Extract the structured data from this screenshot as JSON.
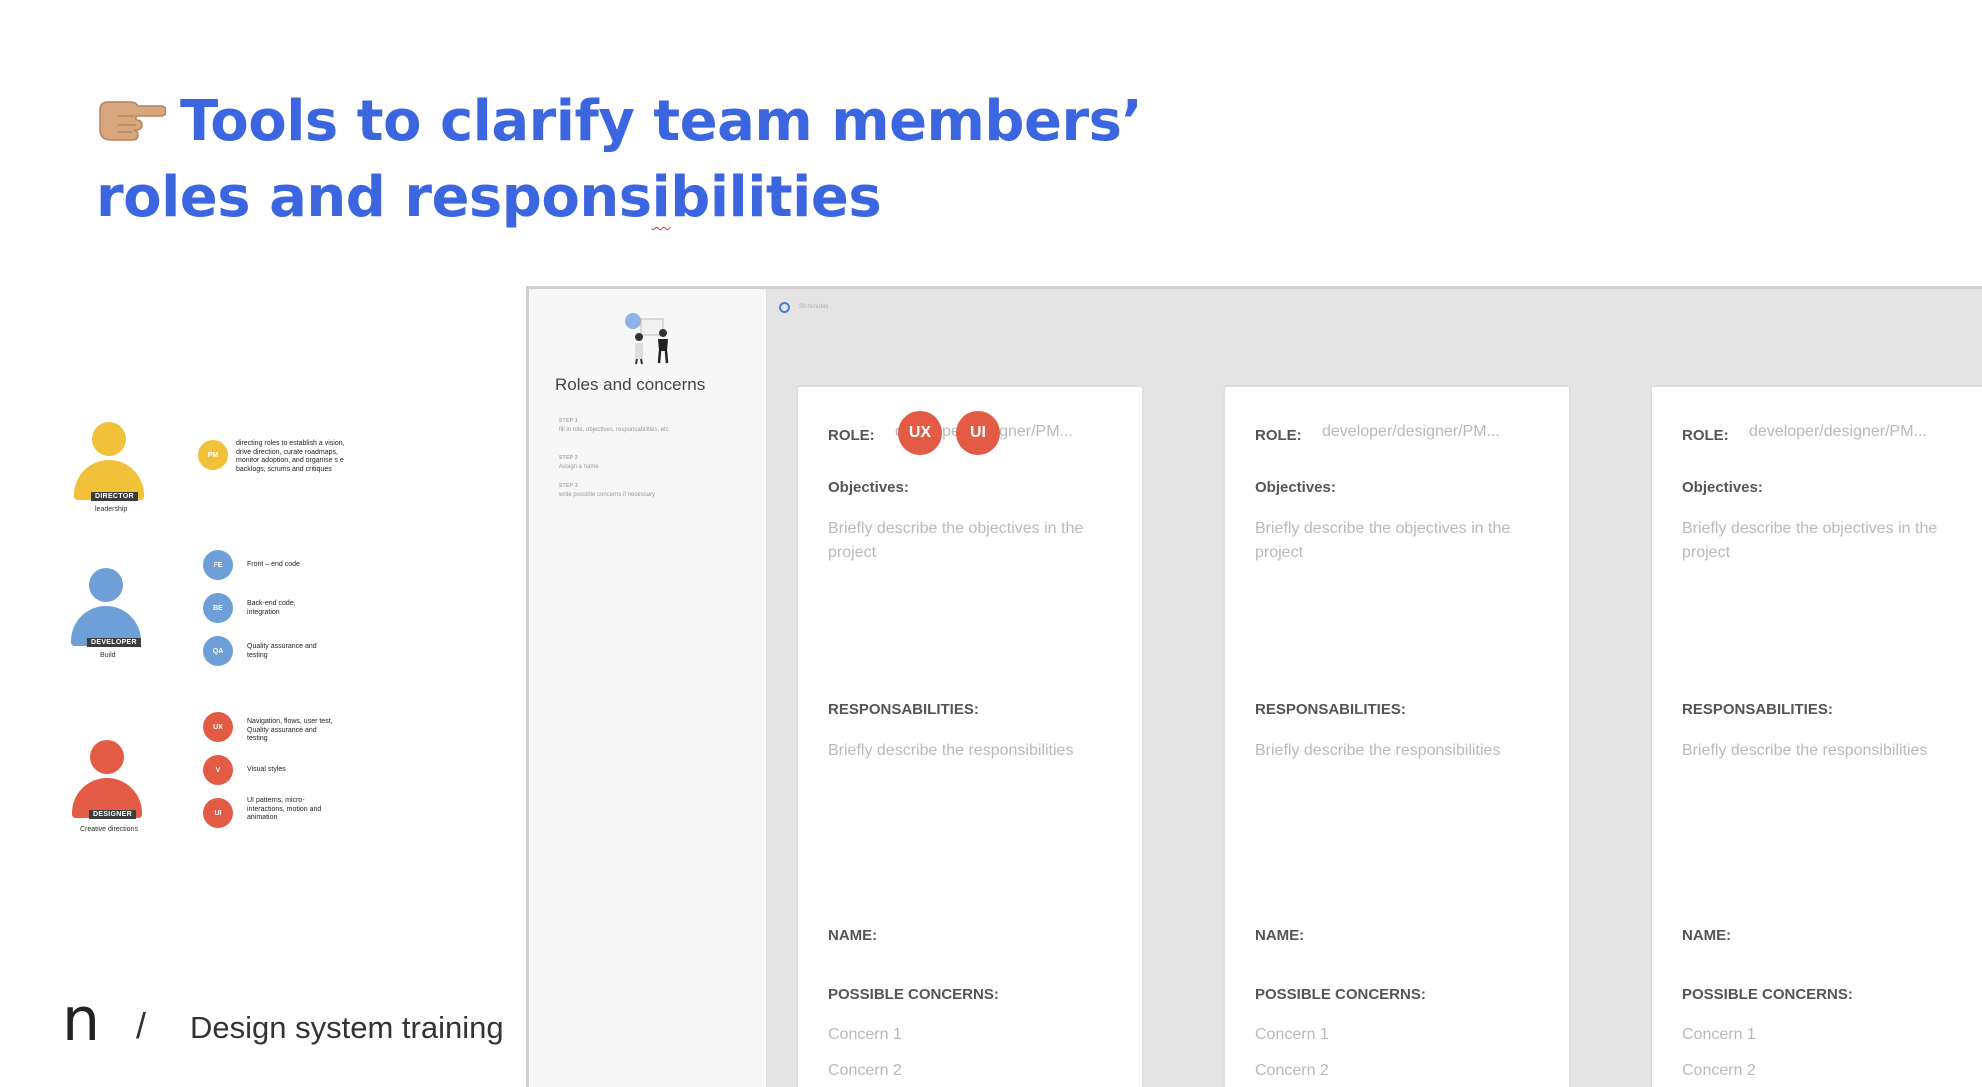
{
  "title": {
    "line1": "Tools to clarify team members’",
    "line2a": "roles and respons",
    "line2b": "i",
    "line2c": "bilities"
  },
  "icons": {
    "pointing_hand": "backhand-index-pointing-right"
  },
  "colors": {
    "title": "#3b66e0",
    "director": "#f2c13a",
    "developer": "#6e9fd8",
    "designer": "#e35b45"
  },
  "diagram": {
    "director": {
      "tag": "DIRECTOR",
      "sub": "leadership",
      "chips": [
        {
          "code": "PM",
          "desc": "directing roles to establish a vision, drive direction, curate roadmaps, monitor adoption, and organise s e backlogs, scrums and critiques"
        }
      ]
    },
    "developer": {
      "tag": "DEVELOPER",
      "sub": "Build",
      "chips": [
        {
          "code": "FE",
          "desc": "Front – end code"
        },
        {
          "code": "BE",
          "desc": "Back-end code, integration"
        },
        {
          "code": "QA",
          "desc": "Quality assurance and testing"
        }
      ]
    },
    "designer": {
      "tag": "DESIGNER",
      "sub": "Creative directions",
      "chips": [
        {
          "code": "UX",
          "desc": "Navigation, flows, user test, Quality assurance and testing"
        },
        {
          "code": "V",
          "desc": "Visual styles"
        },
        {
          "code": "UI",
          "desc": "UI patterns, micro-interactions, motion and animation"
        }
      ]
    }
  },
  "footer": {
    "logo": "n",
    "separator": "/",
    "text": "Design system training"
  },
  "board": {
    "side_title": "Roles and concerns",
    "timer": "20 minutes",
    "steps": [
      {
        "label": "STEP 1",
        "text": "fill in role, objectives, responsabilities, etc"
      },
      {
        "label": "STEP 2",
        "text": "Assign a name"
      },
      {
        "label": "STEP 3",
        "text": "write possible concerns if necessary"
      }
    ],
    "badges": [
      "UX",
      "UI"
    ],
    "cards": [
      {
        "role_label": "ROLE:",
        "role_value": "developer/designer/PM...",
        "objectives_label": "Objectives:",
        "objectives_hint": "Briefly describe the objectives in the project",
        "resp_label": "RESPONSABILITIES:",
        "resp_hint": "Briefly describe the responsibilities",
        "name_label": "NAME:",
        "concerns_label": "POSSIBLE CONCERNS:",
        "concern1": "Concern 1",
        "concern2": "Concern 2"
      },
      {
        "role_label": "ROLE:",
        "role_value": "developer/designer/PM...",
        "objectives_label": "Objectives:",
        "objectives_hint": "Briefly describe the objectives in the project",
        "resp_label": "RESPONSABILITIES:",
        "resp_hint": "Briefly describe the responsibilities",
        "name_label": "NAME:",
        "concerns_label": "POSSIBLE CONCERNS:",
        "concern1": "Concern 1",
        "concern2": "Concern 2"
      },
      {
        "role_label": "ROLE:",
        "role_value": "developer/designer/PM...",
        "objectives_label": "Objectives:",
        "objectives_hint": "Briefly describe the objectives in the project",
        "resp_label": "RESPONSABILITIES:",
        "resp_hint": "Briefly describe the responsibilities",
        "name_label": "NAME:",
        "concerns_label": "POSSIBLE CONCERNS:",
        "concern1": "Concern 1",
        "concern2": "Concern 2"
      }
    ]
  }
}
